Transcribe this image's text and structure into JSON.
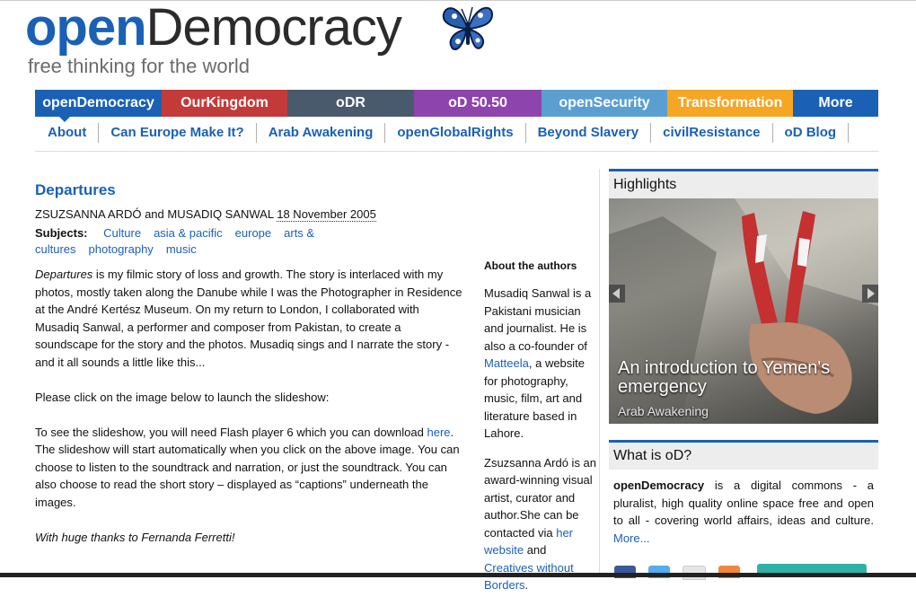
{
  "logo": {
    "open": "open",
    "democracy": "Democracy",
    "tagline": "free thinking for the world"
  },
  "tabs": [
    {
      "label": "openDemocracy",
      "color": "#1a61b5",
      "w": 141
    },
    {
      "label": "OurKingdom",
      "color": "#c33a3a",
      "w": 140
    },
    {
      "label": "oDR",
      "color": "#4a5a6d",
      "w": 141
    },
    {
      "label": "oD 50.50",
      "color": "#8e44ad",
      "w": 142
    },
    {
      "label": "openSecurity",
      "color": "#5b9fd1",
      "w": 140
    },
    {
      "label": "Transformation",
      "color": "#f5a623",
      "w": 140
    },
    {
      "label": "More",
      "color": "#1a61b5",
      "w": 95
    }
  ],
  "subnav": [
    "About",
    "Can Europe Make It?",
    "Arab Awakening",
    "openGlobalRights",
    "Beyond Slavery",
    "civilResistance",
    "oD Blog"
  ],
  "article": {
    "title": "Departures",
    "authors": "ZSUZSANNA ARDÓ and MUSADIQ SANWAL",
    "date": "18 November 2005",
    "subjects_label": "Subjects:",
    "subjects": [
      "Culture",
      "asia & pacific",
      "europe",
      "arts & cultures",
      "photography",
      "music"
    ],
    "p1_em": "Departures",
    "p1_rest": " is my filmic story of loss and growth. The story is interlaced with my photos, mostly taken along the Danube while I was the Photographer in Residence at the André Kertész Museum. On my return to London, I collaborated with Musadiq Sanwal, a performer and composer from Pakistan, to create a soundscape for the story and the photos. Musadiq sings and I narrate the story - and it all sounds a little like this...",
    "p2": "Please click on the image below to launch the slideshow:",
    "p3_a": "To see the slideshow, you will need Flash player 6 which you can download ",
    "p3_link": "here",
    "p3_b": ". The slideshow will start automatically when you click on the above image. You can choose to listen to the soundtrack and narration, or just the soundtrack. You can also choose to read the short story – displayed as “captions” underneath the images.",
    "p4": "With huge thanks to Fernanda Ferretti!"
  },
  "about": {
    "heading": "About the authors",
    "a1_pre": "Musadiq Sanwal is a Pakistani musician and journalist. He is also a co-founder of ",
    "a1_link": "Matteela",
    "a1_post": ", a website for photography, music, film, art and literature based in Lahore.",
    "a2_pre": "Zsuzsanna Ardó is an award-winning visual artist, curator and author.She can be contacted via ",
    "a2_link1": "her website",
    "a2_mid": " and ",
    "a2_link2": "Creatives without Borders",
    "a2_post": "."
  },
  "sidebar": {
    "highlights_title": "Highlights",
    "hero_caption": "An introduction to Yemen's emergency",
    "hero_category": "Arab Awakening",
    "what_title": "What is oD?",
    "what_bold": "openDemocracy",
    "what_text": " is a digital commons - a pluralist, high quality online space free and open to all - covering world affairs, ideas and culture.",
    "what_more": "More..."
  }
}
